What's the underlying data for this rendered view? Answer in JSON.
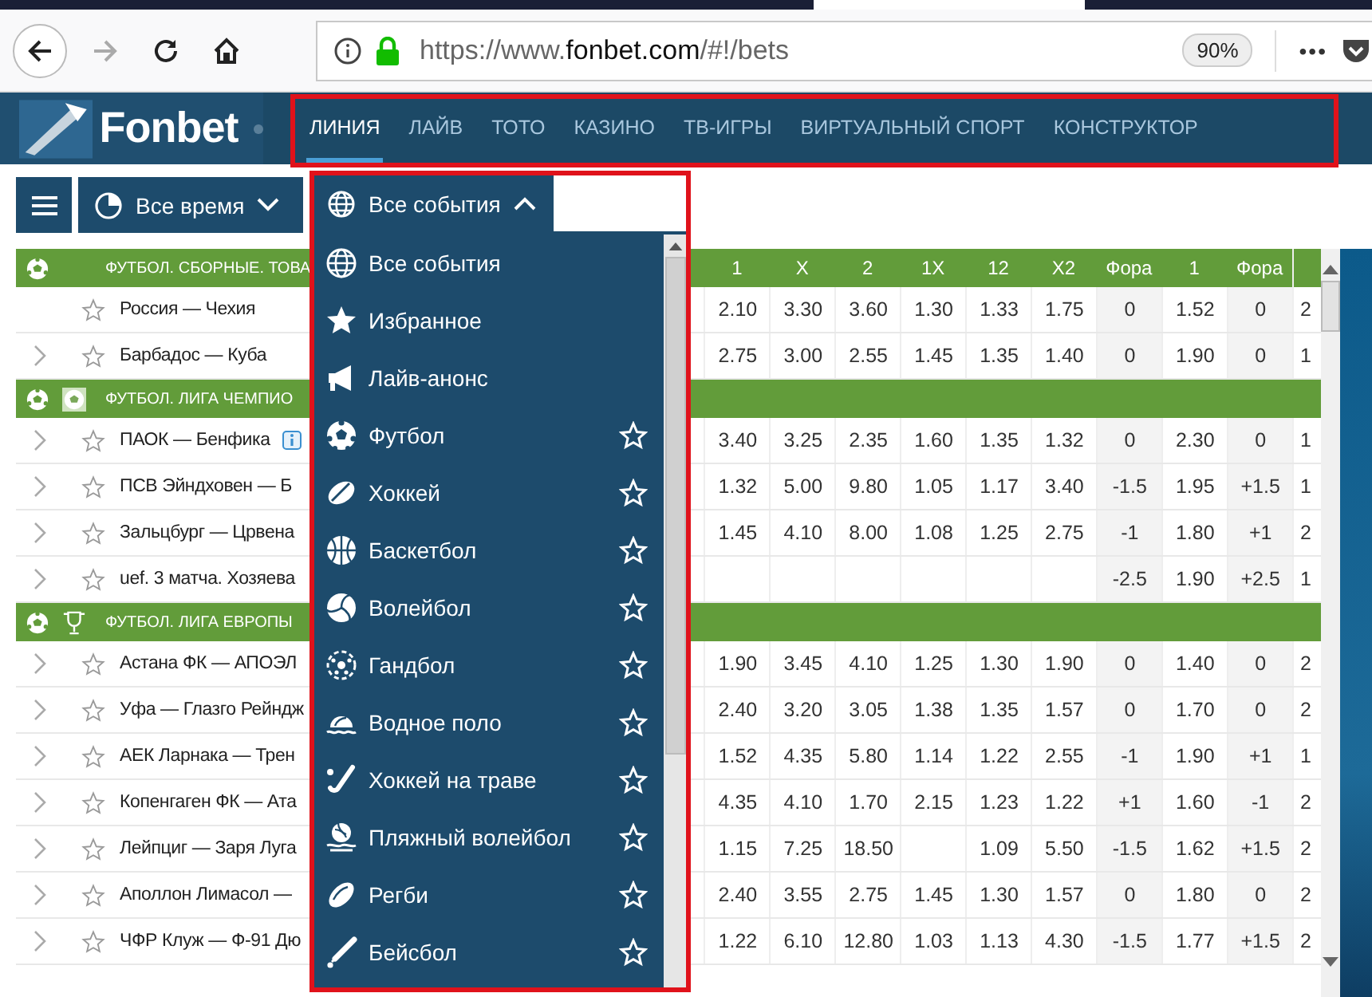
{
  "browser": {
    "url_prefix": "https://www.",
    "url_domain": "fonbet.com",
    "url_path": "/#!/bets",
    "zoom": "90%",
    "menu": "•••",
    "forward_disabled": true
  },
  "site": {
    "logo": "Fonbet",
    "nav": [
      {
        "label": "ЛИНИЯ",
        "selected": true
      },
      {
        "label": "ЛАЙВ",
        "selected": false
      },
      {
        "label": "ТОТО",
        "selected": false
      },
      {
        "label": "КАЗИНО",
        "selected": false
      },
      {
        "label": "ТВ-ИГРЫ",
        "selected": false
      },
      {
        "label": "ВИРТУАЛЬНЫЙ СПОРТ",
        "selected": false
      },
      {
        "label": "КОНСТРУКТОР",
        "selected": false
      }
    ]
  },
  "toolbar": {
    "period": "Все время",
    "filter": "Все события",
    "filter_expanded": true
  },
  "table": {
    "columns": [
      "1",
      "X",
      "2",
      "1X",
      "12",
      "X2",
      "Фора",
      "1",
      "Фора"
    ],
    "groups": [
      {
        "title": "ФУТБОЛ. СБОРНЫЕ. ТОВА",
        "kind": "plain",
        "rows": [
          {
            "name": "Россия — Чехия",
            "expandable": false,
            "info": false,
            "odds": {
              "col_1": "2.10",
              "col_2": "3.30",
              "col_3": "3.60",
              "col_4": "1.30",
              "col_5": "1.33",
              "col_6": "1.75",
              "col_7": "0",
              "col_8": "1.52",
              "col_9": "0"
            },
            "column_10": "2"
          },
          {
            "name": "Барбадос — Куба",
            "expandable": true,
            "info": false,
            "odds": {
              "col_1": "2.75",
              "col_2": "3.00",
              "col_3": "2.55",
              "col_4": "1.45",
              "col_5": "1.35",
              "col_6": "1.40",
              "col_7": "0",
              "col_8": "1.90",
              "col_9": "0"
            },
            "column_10": "1"
          }
        ]
      },
      {
        "title": "ФУТБОЛ. ЛИГА ЧЕМПИО",
        "kind": "ball",
        "rows": [
          {
            "name": "ПАОК — Бенфика",
            "expandable": true,
            "info": true,
            "odds": {
              "col_1": "3.40",
              "col_2": "3.25",
              "col_3": "2.35",
              "col_4": "1.60",
              "col_5": "1.35",
              "col_6": "1.32",
              "col_7": "0",
              "col_8": "2.30",
              "col_9": "0"
            },
            "column_10": "1"
          },
          {
            "name": "ПСВ Эйндховен — Б",
            "expandable": true,
            "info": false,
            "odds": {
              "col_1": "1.32",
              "col_2": "5.00",
              "col_3": "9.80",
              "col_4": "1.05",
              "col_5": "1.17",
              "col_6": "3.40",
              "col_7": "-1.5",
              "col_8": "1.95",
              "col_9": "+1.5"
            },
            "column_10": "1"
          },
          {
            "name": "Зальцбург — Црвена",
            "expandable": true,
            "info": false,
            "odds": {
              "col_1": "1.45",
              "col_2": "4.10",
              "col_3": "8.00",
              "col_4": "1.08",
              "col_5": "1.25",
              "col_6": "2.75",
              "col_7": "-1",
              "col_8": "1.80",
              "col_9": "+1"
            },
            "column_10": "2"
          },
          {
            "name": "uef. 3 матча. Хозяева",
            "expandable": true,
            "info": false,
            "odds": {
              "col_7": "-2.5",
              "col_8": "1.90",
              "col_9": "+2.5"
            },
            "column_10": "1"
          }
        ]
      },
      {
        "title": "ФУТБОЛ. ЛИГА ЕВРОПЫ",
        "kind": "cup",
        "rows": [
          {
            "name": "Астана ФК — АПОЭЛ",
            "expandable": true,
            "info": false,
            "odds": {
              "col_1": "1.90",
              "col_2": "3.45",
              "col_3": "4.10",
              "col_4": "1.25",
              "col_5": "1.30",
              "col_6": "1.90",
              "col_7": "0",
              "col_8": "1.40",
              "col_9": "0"
            },
            "column_10": "2"
          },
          {
            "name": "Уфа — Глазго Рейндж",
            "expandable": true,
            "info": false,
            "odds": {
              "col_1": "2.40",
              "col_2": "3.20",
              "col_3": "3.05",
              "col_4": "1.38",
              "col_5": "1.35",
              "col_6": "1.57",
              "col_7": "0",
              "col_8": "1.70",
              "col_9": "0"
            },
            "column_10": "2"
          },
          {
            "name": "АЕК Ларнака — Трен",
            "expandable": true,
            "info": false,
            "odds": {
              "col_1": "1.52",
              "col_2": "4.35",
              "col_3": "5.80",
              "col_4": "1.14",
              "col_5": "1.22",
              "col_6": "2.55",
              "col_7": "-1",
              "col_8": "1.90",
              "col_9": "+1"
            },
            "column_10": "1"
          },
          {
            "name": "Копенгаген ФК — Ата",
            "expandable": true,
            "info": false,
            "odds": {
              "col_1": "4.35",
              "col_2": "4.10",
              "col_3": "1.70",
              "col_4": "2.15",
              "col_5": "1.23",
              "col_6": "1.22",
              "col_7": "+1",
              "col_8": "1.60",
              "col_9": "-1"
            },
            "column_10": "2"
          },
          {
            "name": "Лейпциг — Заря Луга",
            "expandable": true,
            "info": false,
            "odds": {
              "col_1": "1.15",
              "col_2": "7.25",
              "col_3": "18.50",
              "col_5": "1.09",
              "col_6": "5.50",
              "col_7": "-1.5",
              "col_8": "1.62",
              "col_9": "+1.5"
            },
            "column_10": "2"
          },
          {
            "name": "Аполлон Лимасол —",
            "expandable": true,
            "info": false,
            "odds": {
              "col_1": "2.40",
              "col_2": "3.55",
              "col_3": "2.75",
              "col_4": "1.45",
              "col_5": "1.30",
              "col_6": "1.57",
              "col_7": "0",
              "col_8": "1.80",
              "col_9": "0"
            },
            "column_10": "2"
          },
          {
            "name": "ЧФР Клуж — Ф-91 Дю",
            "expandable": true,
            "info": false,
            "odds": {
              "col_1": "1.22",
              "col_2": "6.10",
              "col_3": "12.80",
              "col_4": "1.03",
              "col_5": "1.13",
              "col_6": "4.30",
              "col_7": "-1.5",
              "col_8": "1.77",
              "col_9": "+1.5"
            },
            "column_10": "2"
          }
        ]
      }
    ]
  },
  "dropdown": {
    "items": [
      {
        "label": "Все события",
        "kind": "globe",
        "favorite_toggle": false
      },
      {
        "label": "Избранное",
        "kind": "star",
        "favorite_toggle": false
      },
      {
        "label": "Лайв-анонс",
        "kind": "megaphone",
        "favorite_toggle": false
      },
      {
        "label": "Футбол",
        "kind": "soccer",
        "favorite_toggle": true
      },
      {
        "label": "Хоккей",
        "kind": "puck",
        "favorite_toggle": true
      },
      {
        "label": "Баскетбол",
        "kind": "basketball",
        "favorite_toggle": true
      },
      {
        "label": "Волейбол",
        "kind": "volleyball",
        "favorite_toggle": true
      },
      {
        "label": "Гандбол",
        "kind": "handball",
        "favorite_toggle": true
      },
      {
        "label": "Водное поло",
        "kind": "waterpolo",
        "favorite_toggle": true
      },
      {
        "label": "Хоккей на траве",
        "kind": "stick",
        "favorite_toggle": true
      },
      {
        "label": "Пляжный волейбол",
        "kind": "beach",
        "favorite_toggle": true
      },
      {
        "label": "Регби",
        "kind": "rugby",
        "favorite_toggle": true
      },
      {
        "label": "Бейсбол",
        "kind": "bat",
        "favorite_toggle": true
      }
    ]
  }
}
